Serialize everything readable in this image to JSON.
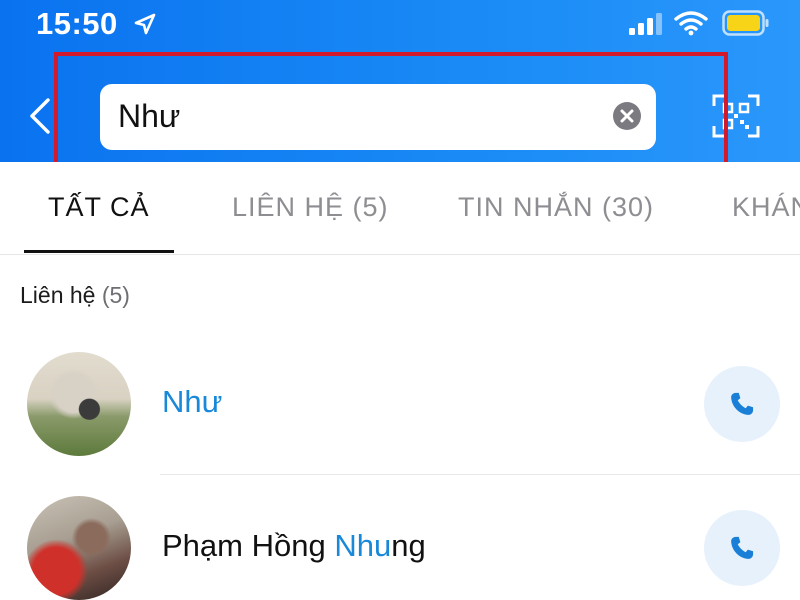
{
  "status_bar": {
    "time": "15:50",
    "icons": [
      "location-arrow-icon",
      "cellular-signal-icon",
      "wifi-icon",
      "battery-icon"
    ]
  },
  "search": {
    "query": "Như",
    "icons": [
      "back-chevron-icon",
      "clear-icon",
      "qr-scan-icon"
    ]
  },
  "tabs": [
    {
      "label": "TẤT CẢ",
      "active": true
    },
    {
      "label": "LIÊN HỆ (5)",
      "active": false
    },
    {
      "label": "TIN NHẮN (30)",
      "active": false
    },
    {
      "label": "KHÁN",
      "active": false
    }
  ],
  "section": {
    "title": "Liên hệ",
    "count": "(5)"
  },
  "contacts": [
    {
      "name_before": "",
      "name_match": "Như",
      "name_after": "",
      "action_icon": "phone-icon"
    },
    {
      "name_before": "Phạm Hồng ",
      "name_match": "Nhu",
      "name_after": "ng",
      "action_icon": "phone-icon"
    }
  ],
  "colors": {
    "header_blue": "#0a72ef",
    "highlight_red": "#d21a2c",
    "match_blue": "#1a88d9",
    "call_button_bg": "#e6f1fc"
  }
}
